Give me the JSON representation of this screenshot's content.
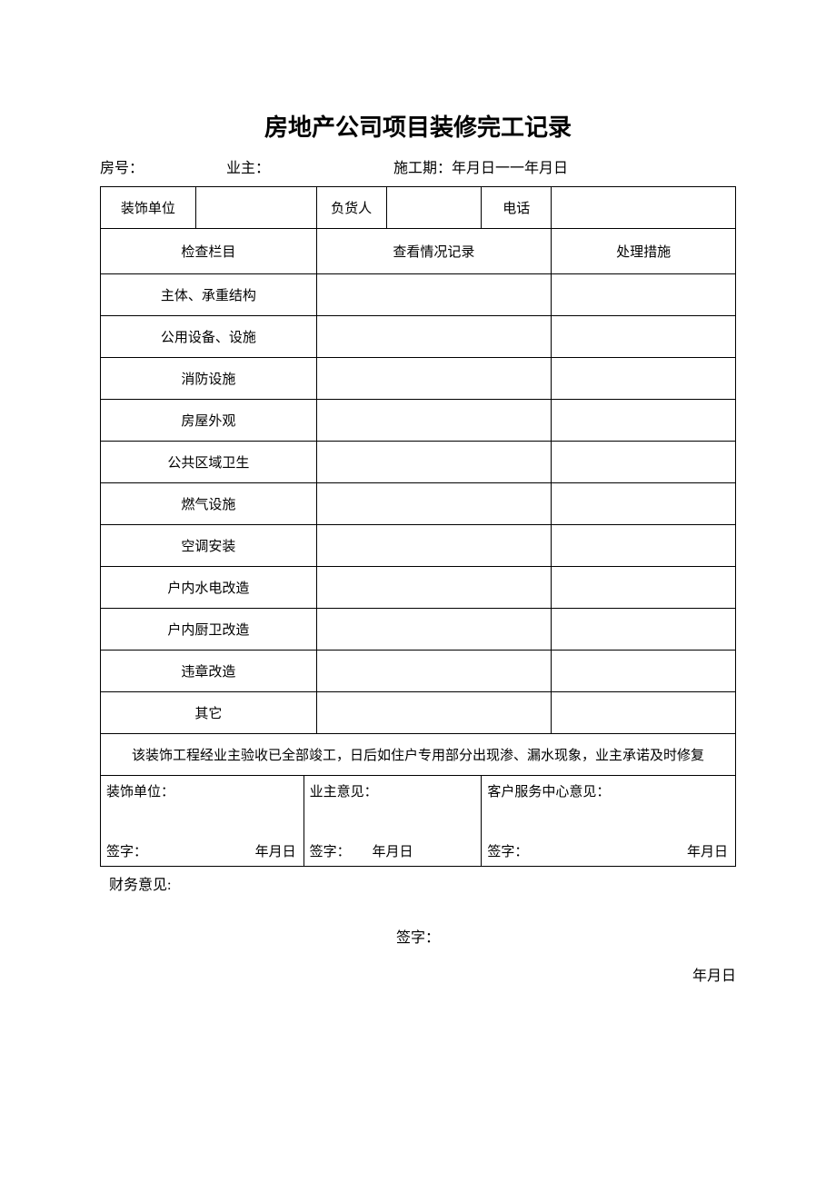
{
  "title": "房地产公司项目装修完工记录",
  "header": {
    "roomLabel": "房号：",
    "ownerLabel": "业主：",
    "periodLabel": "施工期：年月日一一年月日"
  },
  "row1": {
    "unitLabel": "装饰单位",
    "managerLabel": "负货人",
    "phoneLabel": "电话"
  },
  "row2": {
    "checkCol": "检查栏目",
    "recordCol": "查看情况记录",
    "actionCol": "处理措施"
  },
  "items": [
    "主体、承重结构",
    "公用设备、设施",
    "消防设施",
    "房屋外观",
    "公共区域卫生",
    "燃气设施",
    "空调安装",
    "户内水电改造",
    "户内厨卫改造",
    "违章改造",
    "其它"
  ],
  "note": "该装饰工程经业主验收已全部竣工，日后如住户专用部分出现渗、漏水现象，业主承诺及时修复",
  "sign": {
    "unit": "装饰单位：",
    "ownerOpinion": "业主意见：",
    "serviceOpinion": "客户服务中心意见：",
    "signLabel": "签字：",
    "dateLabel": "年月日"
  },
  "finance": {
    "label": "财务意见:",
    "signLabel": "签字：",
    "dateLabel": "年月日"
  }
}
